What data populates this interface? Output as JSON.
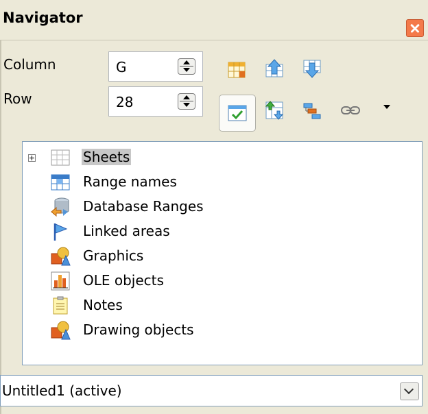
{
  "window": {
    "title": "Navigator"
  },
  "controls": {
    "column_label": "Column",
    "column_value": "G",
    "row_label": "Row",
    "row_value": "28"
  },
  "toolbar": {
    "icons": [
      "data-range-icon",
      "start-icon",
      "end-icon",
      "contents-icon",
      "toggle-icon",
      "scenarios-icon",
      "drag-mode-icon"
    ]
  },
  "tree": {
    "items": [
      {
        "label": "Sheets",
        "icon": "sheets-icon",
        "selected": true,
        "expandable": true
      },
      {
        "label": "Range names",
        "icon": "range-names-icon"
      },
      {
        "label": "Database Ranges",
        "icon": "database-icon"
      },
      {
        "label": "Linked areas",
        "icon": "linked-areas-icon"
      },
      {
        "label": "Graphics",
        "icon": "graphics-icon"
      },
      {
        "label": "OLE objects",
        "icon": "ole-objects-icon"
      },
      {
        "label": "Notes",
        "icon": "notes-icon"
      },
      {
        "label": "Drawing objects",
        "icon": "drawing-objects-icon"
      }
    ]
  },
  "document_select": {
    "value": "Untitled1 (active)"
  }
}
